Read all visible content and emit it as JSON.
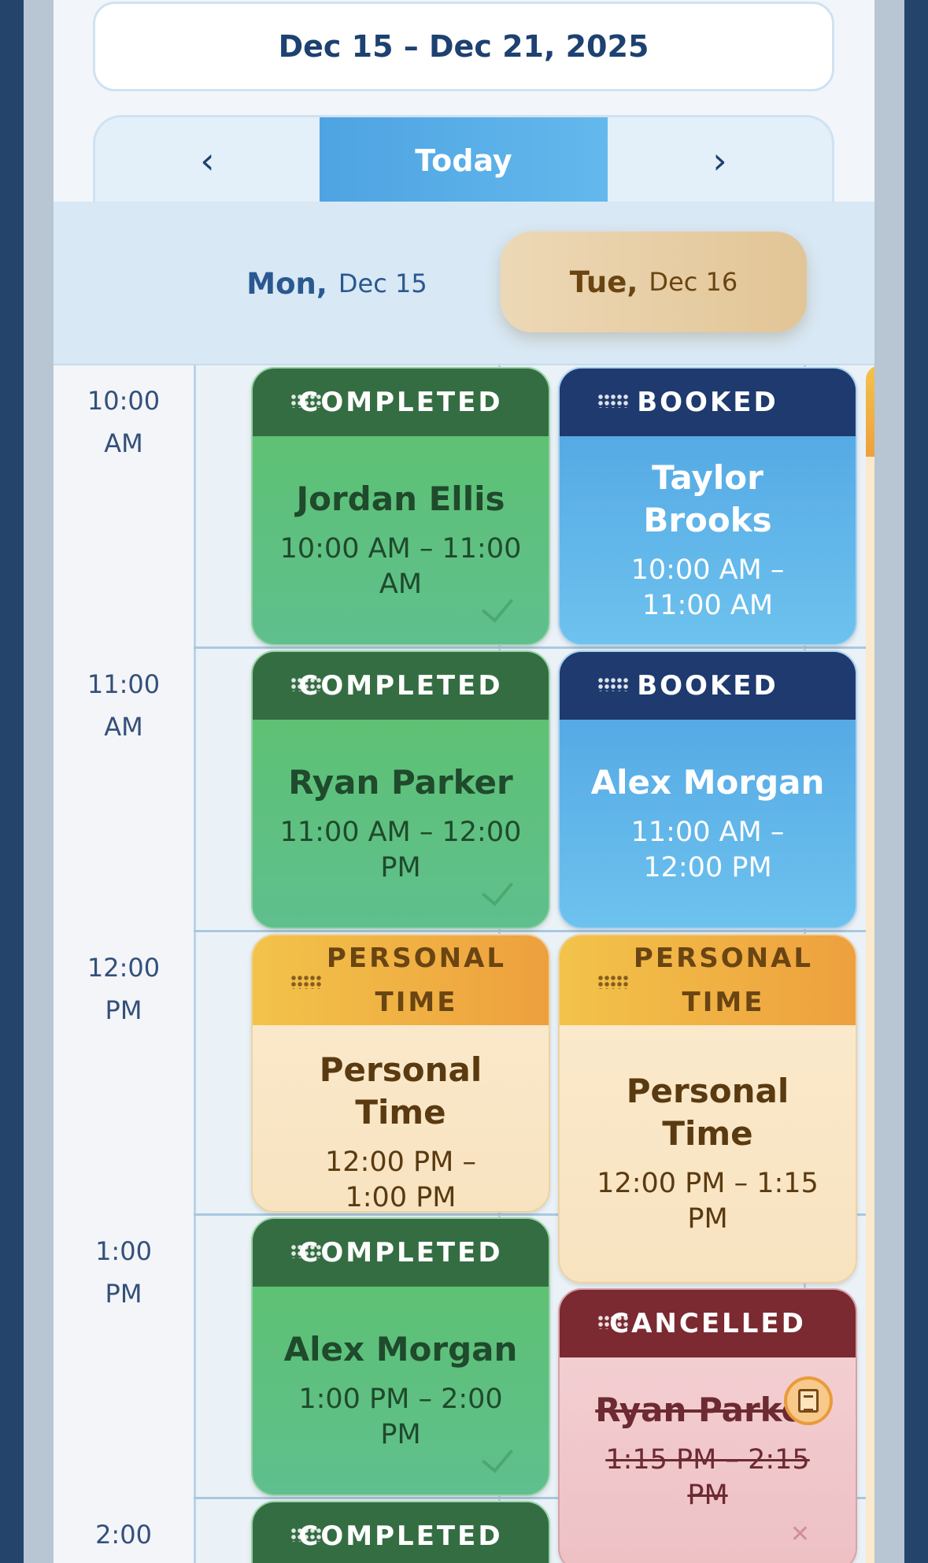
{
  "week": {
    "range": "Dec 15 – Dec 21, 2025"
  },
  "nav": {
    "prev_icon": "chevron-left-icon",
    "today_label": "Today",
    "next_icon": "chevron-right-icon"
  },
  "days": [
    {
      "weekday": "Mon,",
      "date": "Dec 15",
      "selected": false
    },
    {
      "weekday": "Tue,",
      "date": "Dec 16",
      "selected": true
    }
  ],
  "time_slots": [
    {
      "time": "10:00",
      "period": "AM"
    },
    {
      "time": "11:00",
      "period": "AM"
    },
    {
      "time": "12:00",
      "period": "PM"
    },
    {
      "time": "1:00",
      "period": "PM"
    },
    {
      "time": "2:00",
      "period": ""
    }
  ],
  "appointments": {
    "mon": [
      {
        "status": "COMPLETED",
        "name": "Jordan Ellis",
        "time": "10:00 AM – 11:00 AM"
      },
      {
        "status": "COMPLETED",
        "name": "Ryan Parker",
        "time": "11:00 AM – 12:00 PM"
      },
      {
        "status": "PERSONAL TIME",
        "name": "Personal Time",
        "time": "12:00 PM – 1:00 PM"
      },
      {
        "status": "COMPLETED",
        "name": "Alex Morgan",
        "time": "1:00 PM – 2:00 PM"
      },
      {
        "status": "COMPLETED",
        "name": "",
        "time": ""
      }
    ],
    "tue": [
      {
        "status": "BOOKED",
        "name": "Taylor Brooks",
        "time": "10:00 AM – 11:00 AM"
      },
      {
        "status": "BOOKED",
        "name": "Alex Morgan",
        "time": "11:00 AM – 12:00 PM"
      },
      {
        "status": "PERSONAL TIME",
        "name": "Personal Time",
        "time": "12:00 PM – 1:15 PM"
      },
      {
        "status": "CANCELLED",
        "name": "Ryan Parker",
        "time": "1:15 PM – 2:15 PM"
      }
    ]
  },
  "colors": {
    "completed": "#356d43",
    "booked": "#1e3a6e",
    "personal": "#f2c34a",
    "cancelled": "#7a2a30",
    "today_button": "#4ea3e2",
    "selected_day": "#e2c596"
  }
}
